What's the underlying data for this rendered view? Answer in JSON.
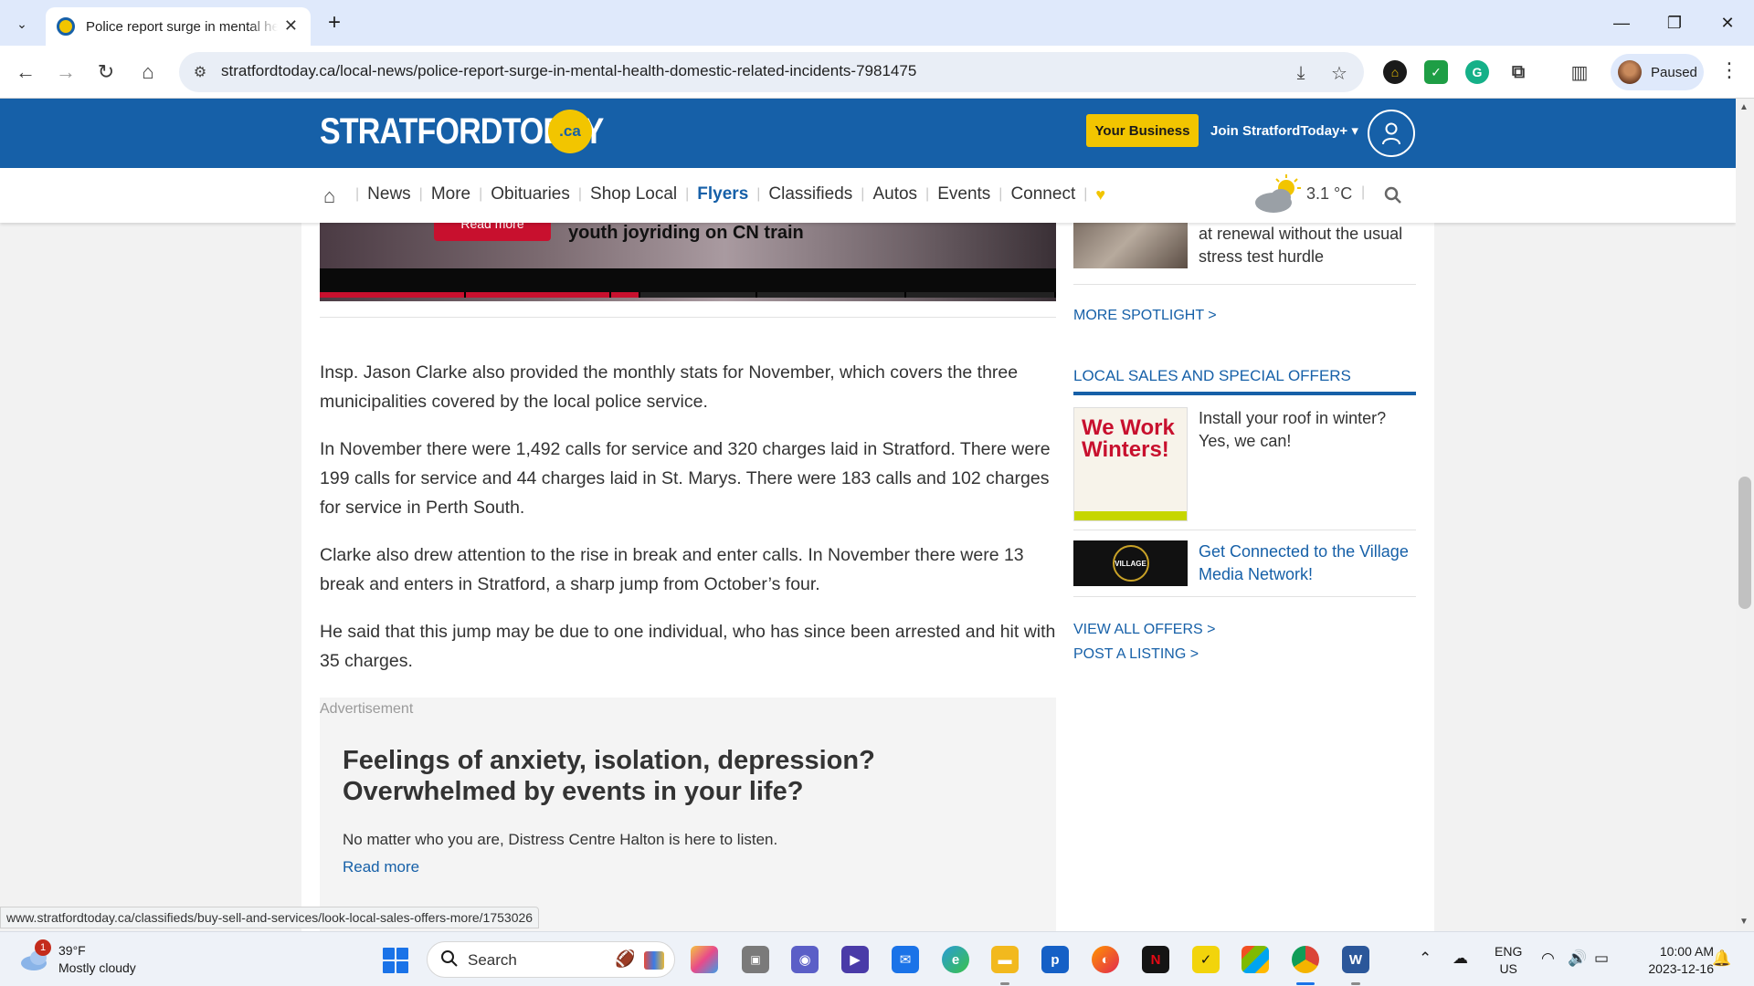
{
  "browser": {
    "tab_title": "Police report surge in mental health domestic related incidents",
    "url": "stratfordtoday.ca/local-news/police-report-surge-in-mental-health-domestic-related-incidents-7981475",
    "profile_label": "Paused",
    "status_url": "www.stratfordtoday.ca/classifieds/buy-sell-and-services/look-local-sales-offers-more/1753026"
  },
  "header": {
    "logo": "STRATFORDTODAY",
    "logo_suffix": ".ca",
    "business_button": "Your Business",
    "join_button": "Join StratfordToday+ ▾"
  },
  "nav": {
    "items": [
      "News",
      "More",
      "Obituaries",
      "Shop Local",
      "Flyers",
      "Classifieds",
      "Autos",
      "Events",
      "Connect"
    ],
    "weather_temp": "3.1 °C"
  },
  "video": {
    "read_more": "Read more",
    "caption": "youth joyriding on CN train",
    "progress_segments": [
      {
        "width": 0.198,
        "color": "#c8102e"
      },
      {
        "width": 0.198,
        "color": "#c8102e"
      },
      {
        "width": 0.04,
        "color": "#c8102e"
      },
      {
        "width": 0.158,
        "color": "#222222"
      },
      {
        "width": 0.202,
        "color": "#222222"
      },
      {
        "width": 0.204,
        "color": "#222222"
      }
    ]
  },
  "article": {
    "paragraphs": [
      "Insp. Jason Clarke also provided the monthly stats for November, which covers the three municipalities covered by the local police service.",
      "In November there were 1,492 calls for service and 320 charges laid in Stratford. There were 199 calls for service and 44 charges laid in St. Marys. There were 183 calls and 102 charges for service in Perth South.",
      "Clarke also drew attention to the rise in break and enter calls. In November there were 13 break and enters in Stratford, a sharp jump from October’s four.",
      "He said that this jump may be due to one individual, who has since been arrested and hit with 35 charges."
    ]
  },
  "ad": {
    "label": "Advertisement",
    "title": "Feelings of anxiety, isolation, depression? Overwhelmed by events in your life?",
    "body": "No matter who you are, Distress Centre Halton is here to listen.",
    "link": "Read more"
  },
  "sidebar": {
    "spotlight_title": "at renewal without the usual stress test hurdle",
    "more_spotlight": "MORE SPOTLIGHT >",
    "sales_heading": "LOCAL SALES AND SPECIAL OFFERS",
    "offer1_image_text": "We Work Winters!",
    "offer1_title": "Install your roof in winter? Yes, we can!",
    "offer2_image_text": "VILLAGE",
    "offer2_title": "Get Connected to the Village Media Network!",
    "view_all": "VIEW ALL OFFERS >",
    "post_listing": "POST A LISTING >"
  },
  "taskbar": {
    "weather_temp": "39°F",
    "weather_cond": "Mostly cloudy",
    "weather_badge": "1",
    "search_label": "Search",
    "lang_1": "ENG",
    "lang_2": "US",
    "time": "10:00 AM",
    "date": "2023-12-16"
  },
  "colors": {
    "brand_blue": "#1660a8",
    "brand_yellow": "#f2c500"
  }
}
